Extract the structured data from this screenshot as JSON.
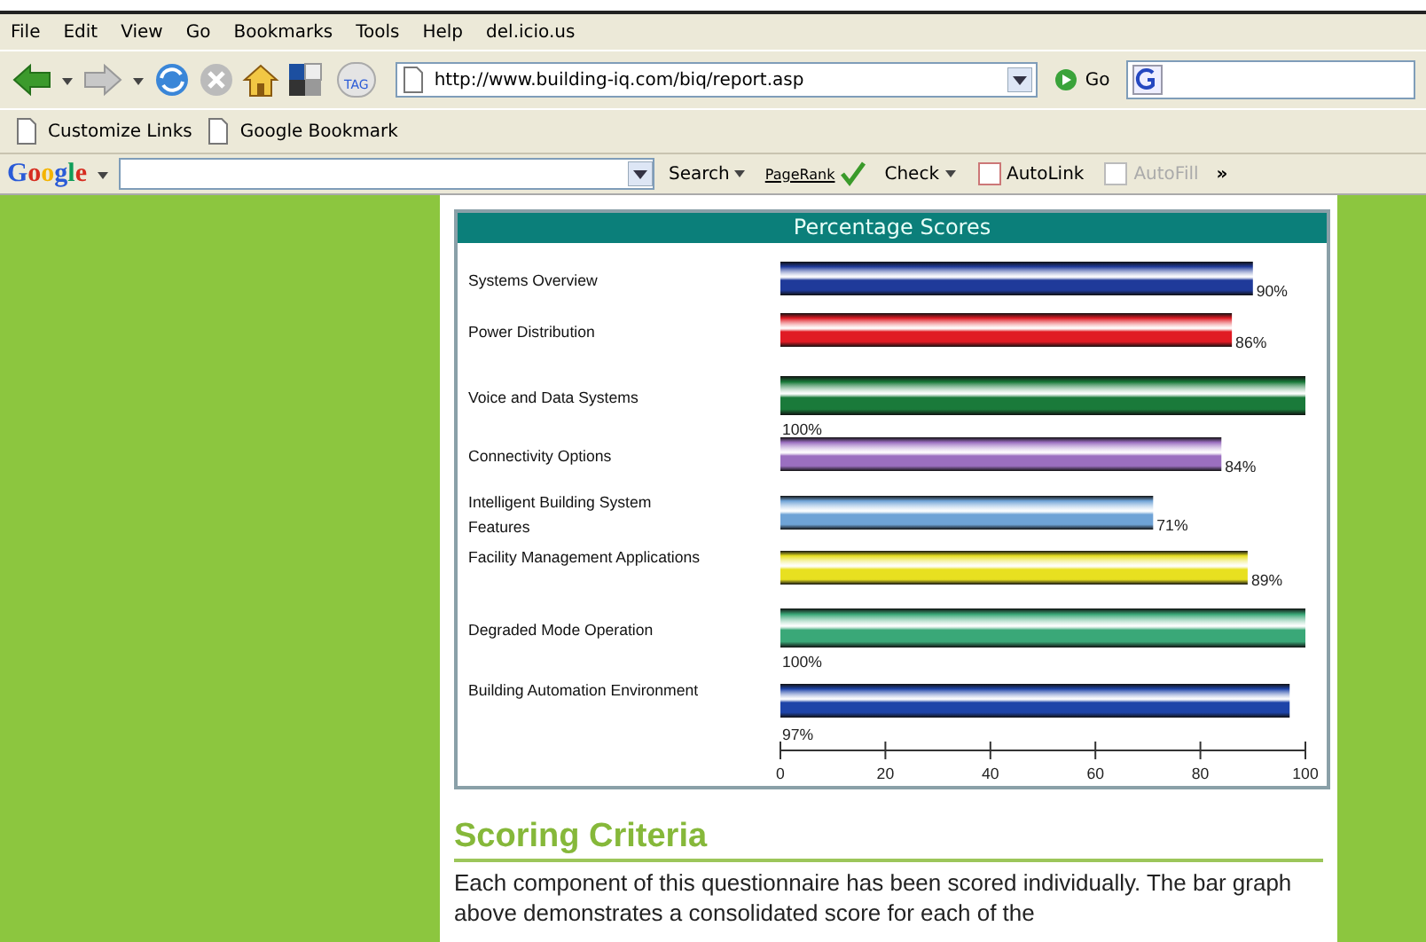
{
  "menu": [
    "File",
    "Edit",
    "View",
    "Go",
    "Bookmarks",
    "Tools",
    "Help",
    "del.icio.us"
  ],
  "nav_toolbar": {
    "tag_label": "TAG",
    "address": "http://www.building-iq.com/biq/report.asp",
    "go": "Go"
  },
  "links_bar": [
    "Customize Links",
    "Google Bookmark"
  ],
  "google_toolbar": {
    "logo": "Google",
    "items": [
      {
        "kind": "menu",
        "label": "Search",
        "disabled": false
      },
      {
        "kind": "pagerank",
        "label": "PageRank",
        "disabled": false
      },
      {
        "kind": "menu",
        "label": "Check",
        "disabled": false
      },
      {
        "kind": "plain",
        "label": "AutoLink",
        "disabled": false
      },
      {
        "kind": "plain",
        "label": "AutoFill",
        "disabled": true
      }
    ],
    "more": "»"
  },
  "report": {
    "chart_data": {
      "type": "bar",
      "title": "Percentage Scores",
      "orientation": "horizontal",
      "categories": [
        "Systems Overview",
        "Power Distribution",
        "Voice and Data Systems",
        "Connectivity Options",
        "Intelligent Building System Features",
        "Facility Management Applications",
        "Degraded Mode Operation",
        "Building Automation Environment"
      ],
      "series": [
        {
          "values": [
            90,
            86,
            100,
            84,
            71,
            89,
            100,
            97
          ]
        }
      ],
      "colors": [
        "#1f3a9a",
        "#e01b24",
        "#1a7a3a",
        "#9b6fc0",
        "#6fa3d6",
        "#e8e020",
        "#3aa878",
        "#1e44a8"
      ],
      "value_labels": [
        "90%",
        "86%",
        "100%",
        "84%",
        "71%",
        "89%",
        "100%",
        "97%"
      ],
      "xlim": [
        0,
        100
      ],
      "xticks": [
        0,
        20,
        40,
        60,
        80,
        100
      ]
    }
  },
  "scoring": {
    "heading": "Scoring Criteria",
    "text": "Each component of this questionnaire has been scored individually. The bar graph above demonstrates a consolidated score for each of the"
  }
}
